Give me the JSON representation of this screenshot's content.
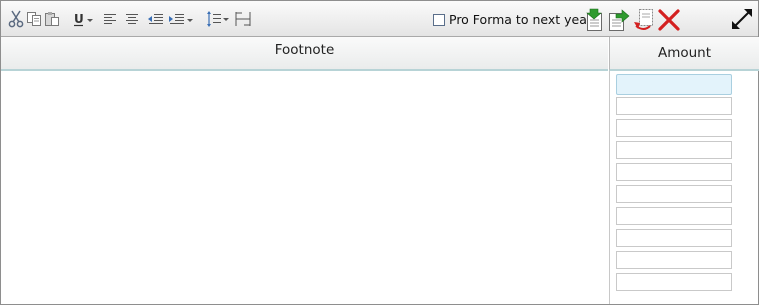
{
  "toolbar": {
    "icons": [
      "cut-icon",
      "copy-icon",
      "paste-icon",
      "underline-icon",
      "align-left-icon",
      "align-center-icon",
      "outdent-icon",
      "indent-icon",
      "line-spacing-icon",
      "column-width-icon",
      "import-icon",
      "export-icon",
      "undo-icon",
      "delete-icon",
      "expand-icon"
    ],
    "underline_label": "U",
    "pro_forma": {
      "label": "Pro Forma to next year",
      "checked": false
    },
    "accent_colors": {
      "green": "#2e9a2e",
      "red": "#d42020"
    }
  },
  "table": {
    "columns": [
      "Footnote",
      "Amount"
    ],
    "amount_values": [
      "",
      "",
      "",
      "",
      "",
      "",
      "",
      "",
      "",
      ""
    ]
  }
}
